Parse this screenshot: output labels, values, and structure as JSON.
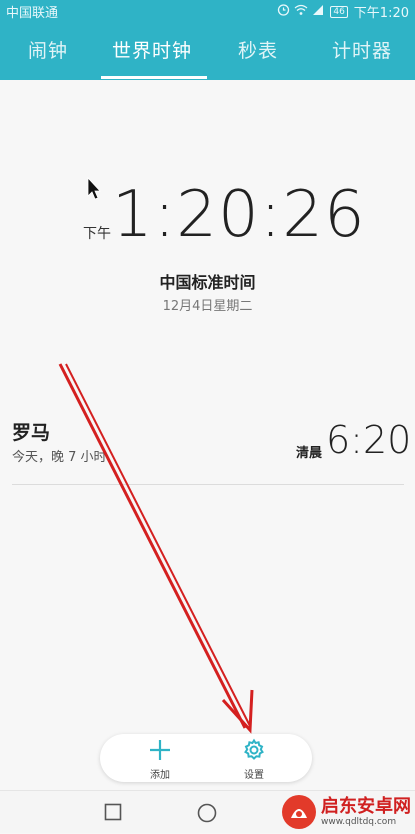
{
  "status_bar": {
    "carrier": "中国联通",
    "battery": "46",
    "time": "下午1:20"
  },
  "tabs": [
    {
      "label": "闹钟",
      "active": false
    },
    {
      "label": "世界时钟",
      "active": true
    },
    {
      "label": "秒表",
      "active": false
    },
    {
      "label": "计时器",
      "active": false
    }
  ],
  "main_clock": {
    "ampm": "下午",
    "time": "1:20:26",
    "timezone": "中国标准时间",
    "date": "12月4日星期二"
  },
  "cities": [
    {
      "name": "罗马",
      "diff": "今天，晚 7 小时",
      "ampm": "清晨",
      "time": "6:20"
    }
  ],
  "actions": {
    "add_label": "添加",
    "settings_label": "设置"
  },
  "watermark": {
    "name": "启东安卓网",
    "url": "www.qdltdq.com"
  },
  "colors": {
    "accent": "#2fb3c6",
    "annotation": "#d42020"
  }
}
